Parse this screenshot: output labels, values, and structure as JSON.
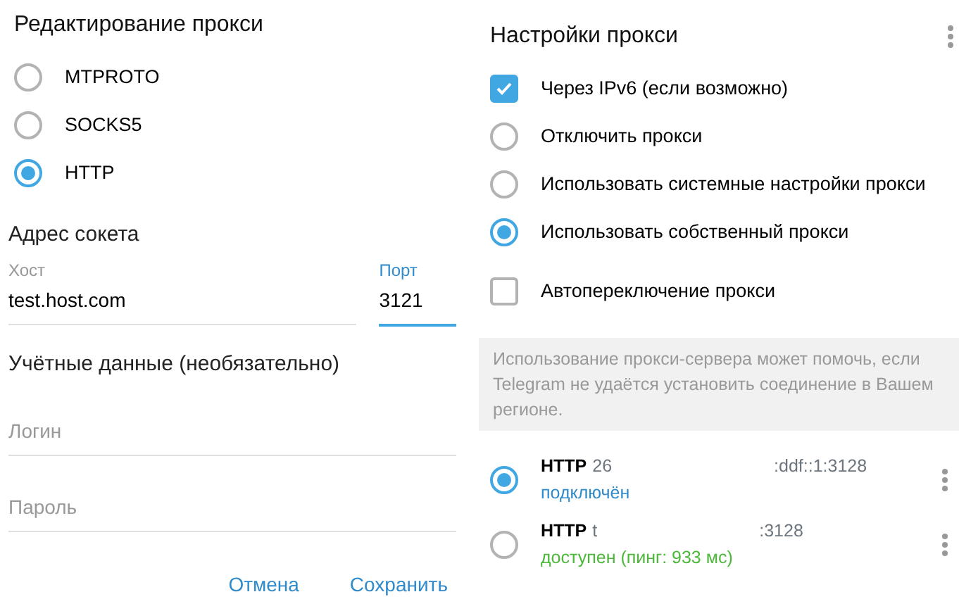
{
  "edit_panel": {
    "title": "Редактирование прокси",
    "types": [
      {
        "label": "MTPROTO",
        "selected": false
      },
      {
        "label": "SOCKS5",
        "selected": false
      },
      {
        "label": "HTTP",
        "selected": true
      }
    ],
    "socket_section": "Адрес сокета",
    "host": {
      "label": "Хост",
      "value": "test.host.com",
      "focused": false
    },
    "port": {
      "label": "Порт",
      "value": "3121",
      "focused": true
    },
    "credentials_section": "Учётные данные (необязательно)",
    "login": {
      "placeholder": "Логин"
    },
    "password": {
      "placeholder": "Пароль"
    },
    "buttons": [
      "Отмена",
      "Сохранить"
    ]
  },
  "settings_panel": {
    "title": "Настройки прокси",
    "options": [
      {
        "kind": "checkbox",
        "label": "Через IPv6 (если возможно)",
        "checked": true
      },
      {
        "kind": "radio",
        "label": "Отключить прокси",
        "selected": false
      },
      {
        "kind": "radio",
        "label": "Использовать системные настройки прокси",
        "selected": false
      },
      {
        "kind": "radio",
        "label": "Использовать собственный прокси",
        "selected": true
      },
      {
        "kind": "checkbox",
        "label": "Автопереключение прокси",
        "checked": false
      }
    ],
    "info": "Использование прокси-сервера может помочь, если Telegram не удаётся установить соединение в Вашем регионе.",
    "proxies": [
      {
        "type": "HTTP",
        "address_start": "26",
        "address_end": ":ddf::1:3128",
        "status": "подключён",
        "color": "#2f8bcc",
        "selected": true
      },
      {
        "type": "HTTP",
        "address_start": "t",
        "address_end": ":3128",
        "status": "доступен (пинг: 933 мс)",
        "color": "#4cb83a",
        "selected": false
      }
    ]
  }
}
